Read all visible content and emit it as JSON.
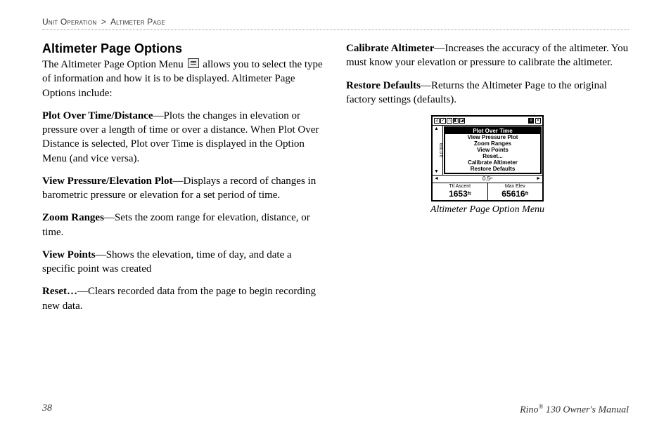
{
  "breadcrumb": {
    "section": "Unit Operation",
    "separator": ">",
    "page": "Altimeter Page"
  },
  "heading": "Altimeter Page Options",
  "intro_pre": "The Altimeter Page Option Menu ",
  "intro_post": " allows you to select the type of information and how it is to be displayed. Altimeter Page Options include:",
  "options": [
    {
      "term": "Plot Over Time/Distance",
      "desc": "—Plots the changes in elevation or pressure over a length of time or over a distance. When Plot Over Distance is selected, Plot over Time is displayed in the Option Menu (and vice versa)."
    },
    {
      "term": "View Pressure/Elevation Plot",
      "desc": "—Displays a record of changes in barometric pressure or elevation for a set period of time."
    },
    {
      "term": "Zoom Ranges",
      "desc": "—Sets the zoom range for elevation, distance, or time."
    },
    {
      "term": "View Points",
      "desc": "—Shows the elevation, time of day, and date a specific point was created"
    },
    {
      "term": "Reset…",
      "desc": "—Clears recorded data from the page to begin recording new data."
    },
    {
      "term": "Calibrate Altimeter",
      "desc": "—Increases the accuracy of the altimeter. You must know your elevation or pressure to calibrate the altimeter."
    },
    {
      "term": "Restore Defaults",
      "desc": "—Returns the Altimeter Page to the original factory settings (defaults)."
    }
  ],
  "device": {
    "scale_label": "600.0 ft",
    "menu_items": [
      "Plot Over Time",
      "View Pressure Plot",
      "Zoom Ranges",
      "View Points",
      "Reset...",
      "Calibrate Altimeter",
      "Restore Defaults"
    ],
    "width_label": "0.5ⁿ",
    "bottom": [
      {
        "label": "Ttl Ascent",
        "value": "1653",
        "unit": "ft"
      },
      {
        "label": "Max Elev",
        "value": "65616",
        "unit": "ft"
      }
    ]
  },
  "caption": "Altimeter Page Option Menu",
  "footer": {
    "page_number": "38",
    "product_pre": "Rino",
    "product_sup": "®",
    "product_post": " 130 Owner's Manual"
  }
}
